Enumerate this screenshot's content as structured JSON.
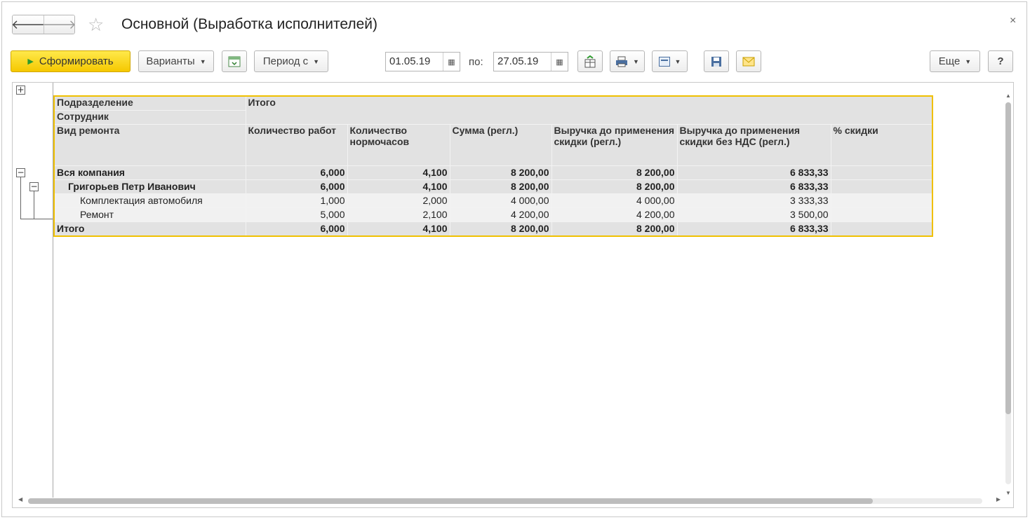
{
  "window": {
    "title": "Основной (Выработка исполнителей)",
    "nav_back": "🡐",
    "nav_forward": "🡒",
    "star": "☆",
    "close": "×"
  },
  "toolbar": {
    "generate_label": "Сформировать",
    "variants_label": "Варианты",
    "period_label": "Период с",
    "date_from": "01.05.19",
    "to_label": "по:",
    "date_to": "27.05.19",
    "more_label": "Еще",
    "help_label": "?"
  },
  "report": {
    "header": {
      "dim1": "Подразделение",
      "dim2": "Сотрудник",
      "dim3": "Вид ремонта",
      "group_total": "Итого",
      "columns": [
        "Количество работ",
        "Количество нормочасов",
        "Сумма (регл.)",
        "Выручка до применения скидки (регл.)",
        "Выручка до применения скидки без НДС (регл.)",
        "% скидки"
      ]
    },
    "rows": [
      {
        "label": "Вся компания",
        "values": [
          "6,000",
          "4,100",
          "8 200,00",
          "8 200,00",
          "6 833,33",
          ""
        ]
      },
      {
        "label": "Григорьев Петр Иванович",
        "values": [
          "6,000",
          "4,100",
          "8 200,00",
          "8 200,00",
          "6 833,33",
          ""
        ]
      },
      {
        "label": "Комплектация автомобиля",
        "values": [
          "1,000",
          "2,000",
          "4 000,00",
          "4 000,00",
          "3 333,33",
          ""
        ]
      },
      {
        "label": "Ремонт",
        "values": [
          "5,000",
          "2,100",
          "4 200,00",
          "4 200,00",
          "3 500,00",
          ""
        ]
      },
      {
        "label": "Итого",
        "values": [
          "6,000",
          "4,100",
          "8 200,00",
          "8 200,00",
          "6 833,33",
          ""
        ]
      }
    ]
  },
  "colors": {
    "accent": "#f5c800",
    "table_border": "#f0c000",
    "play_icon": "#2e9b2e"
  }
}
